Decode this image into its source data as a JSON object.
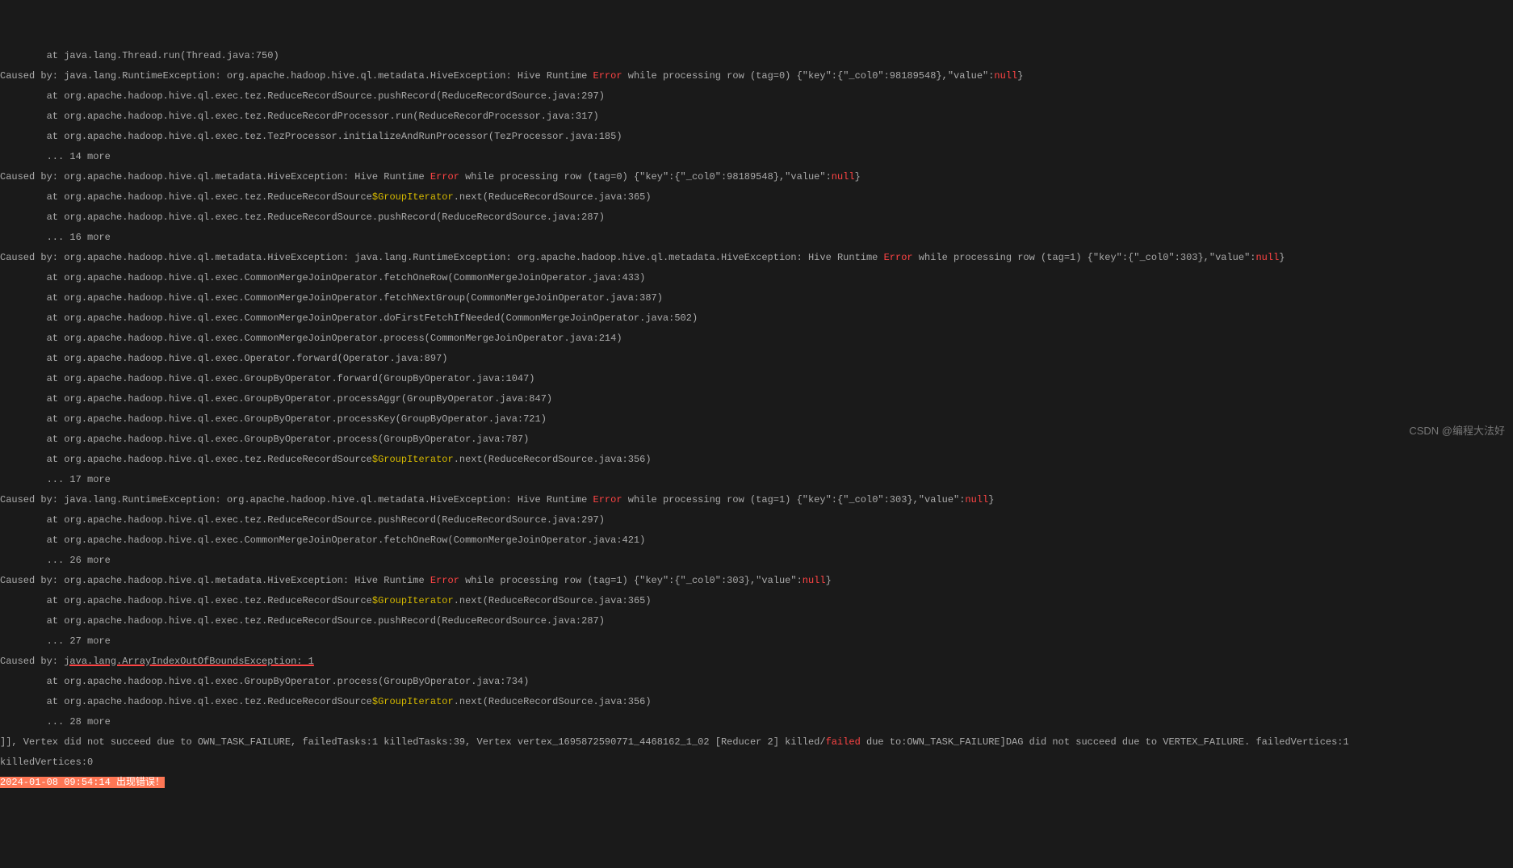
{
  "tab1": {
    "l0": "        at java.lang.Thread.run(Thread.java:750)",
    "cb": "Caused by:",
    "p1a": " java.lang.RuntimeException: org.apache.hadoop.hive.ql.metadata.HiveException: Hive Runtime ",
    "err": "Error",
    "p1b": " while processing row (tag=0) {\"key\":{\"_col0\":98189548},\"value\":",
    "nullw": "null",
    "p1c": "}",
    "l1": "        at org.apache.hadoop.hive.ql.exec.tez.ReduceRecordSource.pushRecord(ReduceRecordSource.java:297)",
    "l2": "        at org.apache.hadoop.hive.ql.exec.tez.ReduceRecordProcessor.run(ReduceRecordProcessor.java:317)",
    "l3": "        at org.apache.hadoop.hive.ql.exec.tez.TezProcessor.initializeAndRunProcessor(TezProcessor.java:185)",
    "l4": "        ... 14 more",
    "p2a": " org.apache.hadoop.hive.ql.metadata.HiveException: Hive Runtime ",
    "p2b": " while processing row (tag=0) {\"key\":{\"_col0\":98189548},\"value\":",
    "l5a": "        at org.apache.hadoop.hive.ql.exec.tez.ReduceRecordSource",
    "gi": "$GroupIterator",
    "l5b": ".next(ReduceRecordSource.java:365)",
    "l6": "        at org.apache.hadoop.hive.ql.exec.tez.ReduceRecordSource.pushRecord(ReduceRecordSource.java:287)",
    "l7": "        ... 16 more",
    "p3a": " org.apache.hadoop.hive.ql.metadata.HiveException: java.lang.RuntimeException: org.apache.hadoop.hive.ql.metadata.HiveException: Hive Runtime ",
    "p3b": " while processing row (tag=1) {\"key\":{\"_col0\":303},\"value\":",
    "l8": "        at org.apache.hadoop.hive.ql.exec.CommonMergeJoinOperator.fetchOneRow(CommonMergeJoinOperator.java:433)",
    "l9": "        at org.apache.hadoop.hive.ql.exec.CommonMergeJoinOperator.fetchNextGroup(CommonMergeJoinOperator.java:387)",
    "l10": "        at org.apache.hadoop.hive.ql.exec.CommonMergeJoinOperator.doFirstFetchIfNeeded(CommonMergeJoinOperator.java:502)",
    "l11": "        at org.apache.hadoop.hive.ql.exec.CommonMergeJoinOperator.process(CommonMergeJoinOperator.java:214)",
    "l12": "        at org.apache.hadoop.hive.ql.exec.Operator.forward(Operator.java:897)",
    "l13": "        at org.apache.hadoop.hive.ql.exec.GroupByOperator.forward(GroupByOperator.java:1047)",
    "l14": "        at org.apache.hadoop.hive.ql.exec.GroupByOperator.processAggr(GroupByOperator.java:847)",
    "l15": "        at org.apache.hadoop.hive.ql.exec.GroupByOperator.processKey(GroupByOperator.java:721)",
    "l16": "        at org.apache.hadoop.hive.ql.exec.GroupByOperator.process(GroupByOperator.java:787)",
    "l17b": ".next(ReduceRecordSource.java:356)",
    "l18": "        ... 17 more",
    "p4a": " java.lang.RuntimeException: org.apache.hadoop.hive.ql.metadata.HiveException: Hive Runtime ",
    "p4b": " while processing row (tag=1) {\"key\":{\"_col0\":303},\"value\":",
    "l19": "        at org.apache.hadoop.hive.ql.exec.tez.ReduceRecordSource.pushRecord(ReduceRecordSource.java:297)",
    "l20": "        at org.apache.hadoop.hive.ql.exec.CommonMergeJoinOperator.fetchOneRow(CommonMergeJoinOperator.java:421)",
    "l21": "        ... 26 more",
    "p5a": " org.apache.hadoop.hive.ql.metadata.HiveException: Hive Runtime ",
    "p5b": " while processing row (tag=1) {\"key\":{\"_col0\":303},\"value\":",
    "l22": "        ... 27 more",
    "p6a": " ",
    "p6u": "java.lang.ArrayIndexOutOfBoundsException: 1",
    "l23": "        at org.apache.hadoop.hive.ql.exec.GroupByOperator.process(GroupByOperator.java:734)",
    "l24": "        ... 28 more",
    "v1a": "]], Vertex did not succeed due to OWN_TASK_FAILURE, failedTasks:1 killedTasks:39, Vertex vertex_1695872590771_4468162_1_02 [Reducer 2] killed/",
    "failed": "failed",
    "v1b": " due to:OWN_TASK_FAILURE]DAG did not succeed due to VERTEX_FAILURE. failedVertices:1",
    "v2": "killedVertices:0",
    "ts": "2024-01-08 09:54:14 出现错误！"
  },
  "watermark": "CSDN @编程大法好"
}
